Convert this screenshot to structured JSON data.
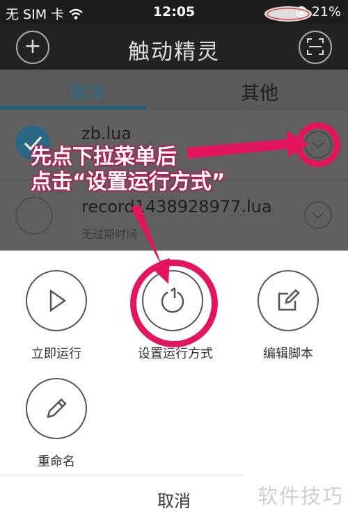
{
  "status_bar": {
    "carrier": "无 SIM 卡",
    "time": "12:05",
    "battery": "21%"
  },
  "nav": {
    "title": "触动精灵",
    "add_icon": "plus-icon",
    "scan_icon": "scan-icon"
  },
  "tabs": [
    {
      "label": "脚本",
      "active": true
    },
    {
      "label": "其他",
      "active": false
    }
  ],
  "scripts": [
    {
      "name": "zb.lua",
      "subtitle": "",
      "selected": true
    },
    {
      "name": "record1438928977.lua",
      "subtitle": "无过期时间",
      "selected": false
    }
  ],
  "sheet": {
    "actions": [
      {
        "label": "立即运行",
        "icon": "play-icon"
      },
      {
        "label": "设置运行方式",
        "icon": "power-cycle-icon"
      },
      {
        "label": "编辑脚本",
        "icon": "edit-icon"
      },
      {
        "label": "重命名",
        "icon": "pencil-icon"
      }
    ],
    "cancel": "取消"
  },
  "annotation": {
    "line1": "先点下拉菜单后",
    "line2": "点击“设置运行方式”",
    "color": "#e4155f"
  },
  "watermark": "软件技巧",
  "colors": {
    "accent": "#2c6c86",
    "annotation": "#e4155f",
    "status_bg": "#1c1c1c"
  }
}
